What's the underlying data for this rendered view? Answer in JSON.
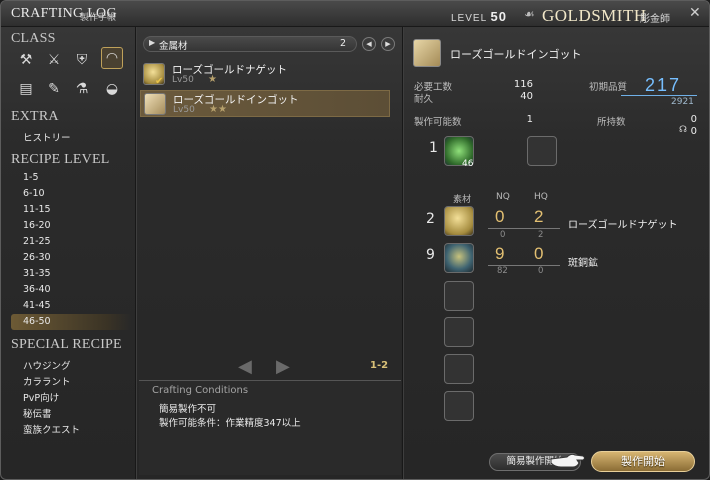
{
  "titlebar": {
    "title": "CRAFTING LOG",
    "subtitle": "製作手帳",
    "level_prefix": "LEVEL",
    "level_value": "50",
    "class_name": "GOLDSMITH",
    "class_name_ja": "彫金師",
    "tools_icon": "crossed-tools-icon"
  },
  "sidebar": {
    "class_heading": "CLASS",
    "extra_heading": "EXTRA",
    "extra_items": [
      "ヒストリー"
    ],
    "recipe_level_heading": "RECIPE LEVEL",
    "recipe_levels": [
      "1-5",
      "6-10",
      "11-15",
      "16-20",
      "21-25",
      "26-30",
      "31-35",
      "36-40",
      "41-45",
      "46-50"
    ],
    "selected_level": "46-50",
    "special_heading": "SPECIAL RECIPE",
    "special_items": [
      "ハウジング",
      "カララント",
      "PvP向け",
      "秘伝書",
      "蛮族クエスト"
    ],
    "classes": [
      "carpenter",
      "blacksmith",
      "armorer",
      "goldsmith",
      "leatherworker",
      "weaver",
      "alchemist",
      "culinarian"
    ],
    "selected_class": "goldsmith"
  },
  "recipe_list": {
    "filter_label": "金属材",
    "filter_count": "2",
    "items": [
      {
        "name": "ローズゴールドナゲット",
        "level": "Lv50",
        "stars": "★"
      },
      {
        "name": "ローズゴールドインゴット",
        "level": "Lv50",
        "stars": "★★"
      }
    ],
    "selected_index": 1,
    "page_indicator": "1-2"
  },
  "conditions": {
    "title": "Crafting Conditions",
    "lines": [
      "簡易製作不可",
      "製作可能条件：作業精度347以上"
    ]
  },
  "detail": {
    "item_name": "ローズゴールドインゴット",
    "required_progress_label": "必要工数",
    "required_progress": "116",
    "durability_label": "耐久",
    "durability": "40",
    "initial_quality_label": "初期品質",
    "initial_quality": "217",
    "max_quality": "2921",
    "craftable_label": "製作可能数",
    "craftable": "1",
    "owned_label": "所持数",
    "owned": "0",
    "owned_hq": "0",
    "crystal_qty": "1",
    "crystal_owned": "46",
    "materials_label": "素材",
    "nq_label": "NQ",
    "hq_label": "HQ",
    "materials": [
      {
        "qty": "2",
        "nq": "0",
        "hq": "2",
        "nq_owned": "0",
        "hq_owned": "2",
        "name": "ローズゴールドナゲット"
      },
      {
        "qty": "9",
        "nq": "9",
        "hq": "0",
        "nq_owned": "82",
        "hq_owned": "0",
        "name": "斑銅鉱"
      }
    ]
  },
  "buttons": {
    "quick_synthesis": "簡易製作開始",
    "synthesize": "製作開始"
  }
}
